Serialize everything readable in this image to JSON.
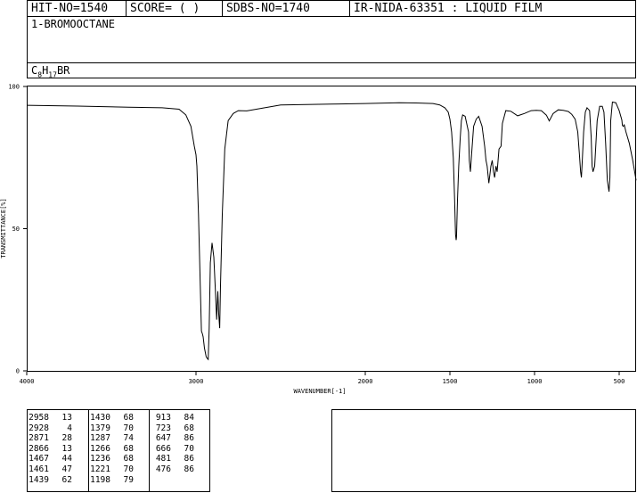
{
  "header": {
    "hit_no": "HIT-NO=1540",
    "score": "SCORE=  (   )",
    "sdbs_no": "SDBS-NO=1740",
    "ir_id": "IR-NIDA-63351 : LIQUID FILM",
    "compound": "1-BROMOOCTANE",
    "formula_parts": [
      "C",
      "8",
      "H",
      "17",
      "BR"
    ]
  },
  "chart_data": {
    "type": "line",
    "xlabel": "WAVENUMBER[-1]",
    "ylabel": "TRANSMITTANCE[%]",
    "xlim": [
      4000,
      400
    ],
    "ylim": [
      0,
      100
    ],
    "x_ticks": [
      4000,
      3000,
      2000,
      1500,
      1000,
      500
    ],
    "y_ticks": [
      0,
      50,
      100
    ],
    "grid": false,
    "series": [
      {
        "x": [
          4000,
          3700,
          3400,
          3200,
          3100,
          3060,
          3030,
          3010,
          3000,
          2995,
          2985,
          2975,
          2968,
          2962,
          2958,
          2950,
          2940,
          2935,
          2928,
          2922,
          2915,
          2905,
          2895,
          2885,
          2878,
          2871,
          2866,
          2860,
          2855,
          2845,
          2830,
          2810,
          2780,
          2750,
          2700,
          2500,
          2200,
          2000,
          1800,
          1700,
          1600,
          1560,
          1530,
          1510,
          1500,
          1490,
          1480,
          1472,
          1467,
          1463,
          1461,
          1455,
          1448,
          1439,
          1432,
          1425,
          1410,
          1390,
          1385,
          1379,
          1372,
          1360,
          1345,
          1330,
          1310,
          1295,
          1287,
          1280,
          1270,
          1266,
          1258,
          1250,
          1242,
          1236,
          1228,
          1221,
          1210,
          1198,
          1190,
          1170,
          1140,
          1100,
          1060,
          1020,
          990,
          960,
          930,
          913,
          890,
          860,
          830,
          800,
          780,
          760,
          745,
          735,
          728,
          723,
          718,
          710,
          700,
          690,
          675,
          665,
          660,
          655,
          645,
          630,
          615,
          600,
          590,
          580,
          570,
          560,
          555,
          550,
          540,
          520,
          500,
          484,
          481,
          476,
          470,
          460,
          440,
          420,
          400
        ],
        "y": [
          93.4,
          93.1,
          92.7,
          92.5,
          92,
          90,
          86,
          79,
          76,
          72,
          55,
          30,
          14,
          13,
          12,
          8,
          5,
          4.5,
          4,
          15,
          38,
          45,
          40,
          28,
          18,
          28,
          20,
          15,
          30,
          55,
          78,
          88,
          90.5,
          91.5,
          91.4,
          93.5,
          93.8,
          94,
          94.3,
          94.2,
          94,
          93.5,
          92.5,
          91,
          88.5,
          84,
          75,
          60,
          48,
          46,
          47,
          60,
          72,
          82,
          88,
          90,
          89.5,
          84,
          74,
          70,
          76,
          86,
          88.5,
          89.5,
          86,
          79,
          74,
          72,
          66,
          68,
          72,
          74,
          70,
          68,
          72,
          70,
          78,
          79,
          87,
          91.5,
          91.3,
          89.7,
          90.5,
          91.5,
          91.6,
          91.5,
          89.9,
          87.9,
          90.5,
          91.8,
          91.6,
          91.2,
          90.2,
          88.5,
          84,
          76,
          70,
          68,
          74,
          84,
          91,
          92.5,
          91.5,
          82,
          72,
          70,
          72,
          88,
          93,
          93,
          91,
          80,
          67,
          63,
          68,
          88,
          94.5,
          94.3,
          91.5,
          88.2,
          86.3,
          86,
          86.5,
          84,
          80,
          74,
          67
        ]
      }
    ],
    "peaks": [
      [
        2958,
        13
      ],
      [
        2928,
        4
      ],
      [
        2871,
        28
      ],
      [
        2866,
        13
      ],
      [
        1467,
        44
      ],
      [
        1461,
        47
      ],
      [
        1439,
        62
      ],
      [
        1430,
        68
      ],
      [
        1379,
        70
      ],
      [
        1287,
        74
      ],
      [
        1266,
        68
      ],
      [
        1236,
        68
      ],
      [
        1221,
        70
      ],
      [
        1198,
        79
      ],
      [
        913,
        84
      ],
      [
        723,
        68
      ],
      [
        647,
        86
      ],
      [
        666,
        70
      ],
      [
        481,
        86
      ],
      [
        476,
        86
      ]
    ]
  }
}
